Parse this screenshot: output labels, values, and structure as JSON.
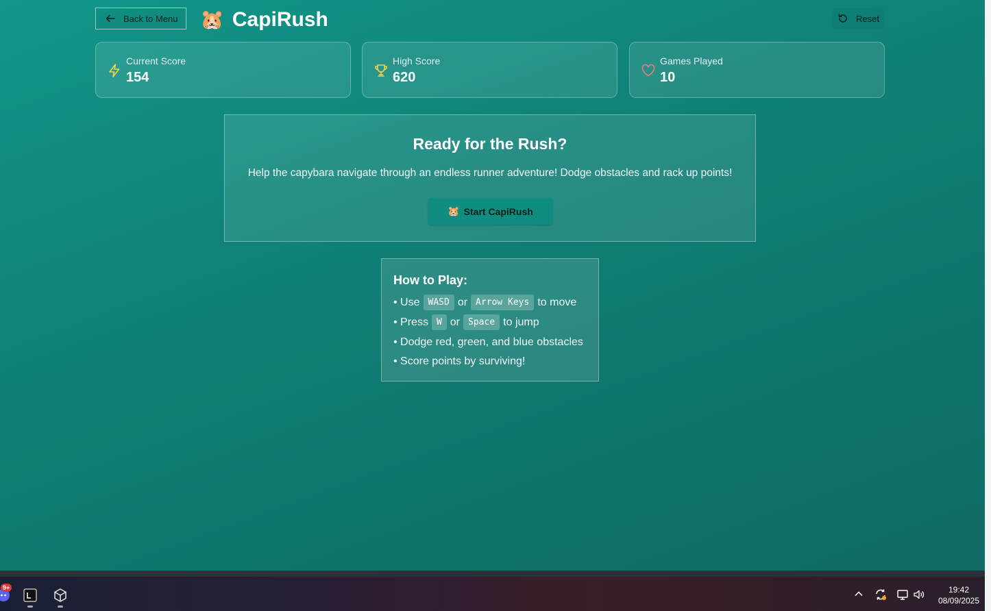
{
  "header": {
    "back_label": "Back to Menu",
    "brand_emoji": "🐹",
    "title": "CapiRush",
    "reset_label": "Reset"
  },
  "stats": [
    {
      "icon": "lightning-icon",
      "label": "Current Score",
      "value": "154",
      "color": "#f6d54a"
    },
    {
      "icon": "trophy-icon",
      "label": "High Score",
      "value": "620",
      "color": "#f6d54a"
    },
    {
      "icon": "heart-icon",
      "label": "Games Played",
      "value": "10",
      "color": "#f07a7a"
    }
  ],
  "hero": {
    "title": "Ready for the Rush?",
    "description": "Help the capybara navigate through an endless runner adventure! Dodge obstacles and rack up points!",
    "start_emoji": "🐹",
    "start_label": "Start CapiRush"
  },
  "howto": {
    "title": "How to Play:",
    "line1": {
      "a": "• Use",
      "k1": "WASD",
      "b": "or",
      "k2": "Arrow Keys",
      "c": "to move"
    },
    "line2": {
      "a": "• Press",
      "k1": "W",
      "b": "or",
      "k2": "Space",
      "c": "to jump"
    },
    "line3": "• Dodge red, green, and blue obstacles",
    "line4": "• Score points by surviving!"
  },
  "taskbar": {
    "badge": "9+",
    "time": "19:42",
    "date": "08/09/2025"
  },
  "colors": {
    "bg_start": "#12968a",
    "bg_end": "#0e6a63",
    "start_button": "#0e8d80"
  }
}
